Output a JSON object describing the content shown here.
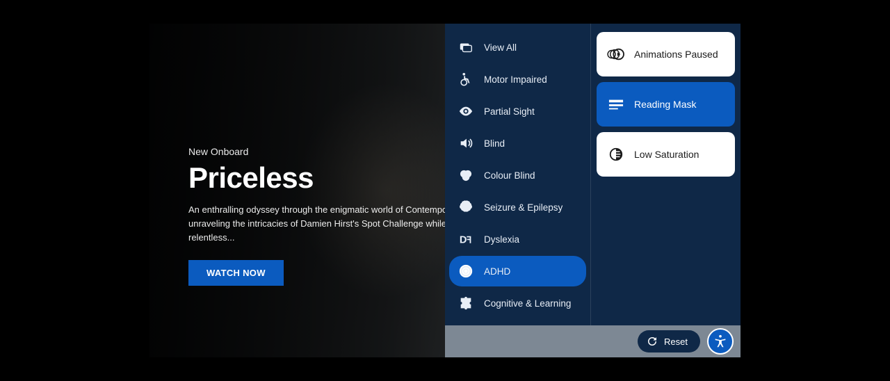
{
  "hero": {
    "eyebrow": "New Onboard",
    "title": "Priceless",
    "desc": "An enthralling odyssey through the enigmatic world of Contemporary Art, unraveling the intricacies of Damien Hirst's Spot Challenge while dissecting the relentless...",
    "cta": "WATCH NOW"
  },
  "profiles": [
    {
      "id": "view-all",
      "label": "View All",
      "active": false
    },
    {
      "id": "motor-impaired",
      "label": "Motor Impaired",
      "active": false
    },
    {
      "id": "partial-sight",
      "label": "Partial Sight",
      "active": false
    },
    {
      "id": "blind",
      "label": "Blind",
      "active": false
    },
    {
      "id": "colour-blind",
      "label": "Colour Blind",
      "active": false
    },
    {
      "id": "seizure-epilepsy",
      "label": "Seizure & Epilepsy",
      "active": false
    },
    {
      "id": "dyslexia",
      "label": "Dyslexia",
      "active": false
    },
    {
      "id": "adhd",
      "label": "ADHD",
      "active": true
    },
    {
      "id": "cognitive-learning",
      "label": "Cognitive & Learning",
      "active": false
    }
  ],
  "options": [
    {
      "id": "animations-paused",
      "label": "Animations Paused",
      "active": false
    },
    {
      "id": "reading-mask",
      "label": "Reading Mask",
      "active": true
    },
    {
      "id": "low-saturation",
      "label": "Low Saturation",
      "active": false
    }
  ],
  "footer": {
    "reset": "Reset"
  },
  "colors": {
    "accent": "#0b5bbf",
    "panel": "#0f2847"
  }
}
